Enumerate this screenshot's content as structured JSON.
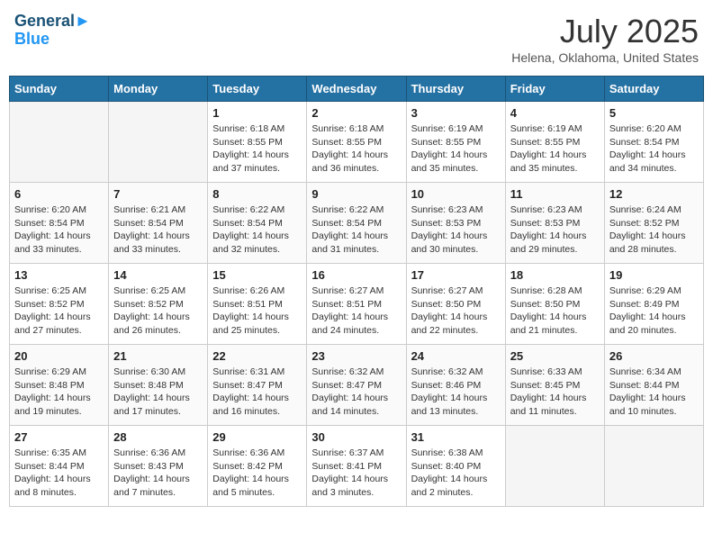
{
  "header": {
    "logo_line1": "General",
    "logo_line2": "Blue",
    "month": "July 2025",
    "location": "Helena, Oklahoma, United States"
  },
  "weekdays": [
    "Sunday",
    "Monday",
    "Tuesday",
    "Wednesday",
    "Thursday",
    "Friday",
    "Saturday"
  ],
  "weeks": [
    [
      {
        "day": "",
        "sunrise": "",
        "sunset": "",
        "daylight": ""
      },
      {
        "day": "",
        "sunrise": "",
        "sunset": "",
        "daylight": ""
      },
      {
        "day": "1",
        "sunrise": "Sunrise: 6:18 AM",
        "sunset": "Sunset: 8:55 PM",
        "daylight": "Daylight: 14 hours and 37 minutes."
      },
      {
        "day": "2",
        "sunrise": "Sunrise: 6:18 AM",
        "sunset": "Sunset: 8:55 PM",
        "daylight": "Daylight: 14 hours and 36 minutes."
      },
      {
        "day": "3",
        "sunrise": "Sunrise: 6:19 AM",
        "sunset": "Sunset: 8:55 PM",
        "daylight": "Daylight: 14 hours and 35 minutes."
      },
      {
        "day": "4",
        "sunrise": "Sunrise: 6:19 AM",
        "sunset": "Sunset: 8:55 PM",
        "daylight": "Daylight: 14 hours and 35 minutes."
      },
      {
        "day": "5",
        "sunrise": "Sunrise: 6:20 AM",
        "sunset": "Sunset: 8:54 PM",
        "daylight": "Daylight: 14 hours and 34 minutes."
      }
    ],
    [
      {
        "day": "6",
        "sunrise": "Sunrise: 6:20 AM",
        "sunset": "Sunset: 8:54 PM",
        "daylight": "Daylight: 14 hours and 33 minutes."
      },
      {
        "day": "7",
        "sunrise": "Sunrise: 6:21 AM",
        "sunset": "Sunset: 8:54 PM",
        "daylight": "Daylight: 14 hours and 33 minutes."
      },
      {
        "day": "8",
        "sunrise": "Sunrise: 6:22 AM",
        "sunset": "Sunset: 8:54 PM",
        "daylight": "Daylight: 14 hours and 32 minutes."
      },
      {
        "day": "9",
        "sunrise": "Sunrise: 6:22 AM",
        "sunset": "Sunset: 8:54 PM",
        "daylight": "Daylight: 14 hours and 31 minutes."
      },
      {
        "day": "10",
        "sunrise": "Sunrise: 6:23 AM",
        "sunset": "Sunset: 8:53 PM",
        "daylight": "Daylight: 14 hours and 30 minutes."
      },
      {
        "day": "11",
        "sunrise": "Sunrise: 6:23 AM",
        "sunset": "Sunset: 8:53 PM",
        "daylight": "Daylight: 14 hours and 29 minutes."
      },
      {
        "day": "12",
        "sunrise": "Sunrise: 6:24 AM",
        "sunset": "Sunset: 8:52 PM",
        "daylight": "Daylight: 14 hours and 28 minutes."
      }
    ],
    [
      {
        "day": "13",
        "sunrise": "Sunrise: 6:25 AM",
        "sunset": "Sunset: 8:52 PM",
        "daylight": "Daylight: 14 hours and 27 minutes."
      },
      {
        "day": "14",
        "sunrise": "Sunrise: 6:25 AM",
        "sunset": "Sunset: 8:52 PM",
        "daylight": "Daylight: 14 hours and 26 minutes."
      },
      {
        "day": "15",
        "sunrise": "Sunrise: 6:26 AM",
        "sunset": "Sunset: 8:51 PM",
        "daylight": "Daylight: 14 hours and 25 minutes."
      },
      {
        "day": "16",
        "sunrise": "Sunrise: 6:27 AM",
        "sunset": "Sunset: 8:51 PM",
        "daylight": "Daylight: 14 hours and 24 minutes."
      },
      {
        "day": "17",
        "sunrise": "Sunrise: 6:27 AM",
        "sunset": "Sunset: 8:50 PM",
        "daylight": "Daylight: 14 hours and 22 minutes."
      },
      {
        "day": "18",
        "sunrise": "Sunrise: 6:28 AM",
        "sunset": "Sunset: 8:50 PM",
        "daylight": "Daylight: 14 hours and 21 minutes."
      },
      {
        "day": "19",
        "sunrise": "Sunrise: 6:29 AM",
        "sunset": "Sunset: 8:49 PM",
        "daylight": "Daylight: 14 hours and 20 minutes."
      }
    ],
    [
      {
        "day": "20",
        "sunrise": "Sunrise: 6:29 AM",
        "sunset": "Sunset: 8:48 PM",
        "daylight": "Daylight: 14 hours and 19 minutes."
      },
      {
        "day": "21",
        "sunrise": "Sunrise: 6:30 AM",
        "sunset": "Sunset: 8:48 PM",
        "daylight": "Daylight: 14 hours and 17 minutes."
      },
      {
        "day": "22",
        "sunrise": "Sunrise: 6:31 AM",
        "sunset": "Sunset: 8:47 PM",
        "daylight": "Daylight: 14 hours and 16 minutes."
      },
      {
        "day": "23",
        "sunrise": "Sunrise: 6:32 AM",
        "sunset": "Sunset: 8:47 PM",
        "daylight": "Daylight: 14 hours and 14 minutes."
      },
      {
        "day": "24",
        "sunrise": "Sunrise: 6:32 AM",
        "sunset": "Sunset: 8:46 PM",
        "daylight": "Daylight: 14 hours and 13 minutes."
      },
      {
        "day": "25",
        "sunrise": "Sunrise: 6:33 AM",
        "sunset": "Sunset: 8:45 PM",
        "daylight": "Daylight: 14 hours and 11 minutes."
      },
      {
        "day": "26",
        "sunrise": "Sunrise: 6:34 AM",
        "sunset": "Sunset: 8:44 PM",
        "daylight": "Daylight: 14 hours and 10 minutes."
      }
    ],
    [
      {
        "day": "27",
        "sunrise": "Sunrise: 6:35 AM",
        "sunset": "Sunset: 8:44 PM",
        "daylight": "Daylight: 14 hours and 8 minutes."
      },
      {
        "day": "28",
        "sunrise": "Sunrise: 6:36 AM",
        "sunset": "Sunset: 8:43 PM",
        "daylight": "Daylight: 14 hours and 7 minutes."
      },
      {
        "day": "29",
        "sunrise": "Sunrise: 6:36 AM",
        "sunset": "Sunset: 8:42 PM",
        "daylight": "Daylight: 14 hours and 5 minutes."
      },
      {
        "day": "30",
        "sunrise": "Sunrise: 6:37 AM",
        "sunset": "Sunset: 8:41 PM",
        "daylight": "Daylight: 14 hours and 3 minutes."
      },
      {
        "day": "31",
        "sunrise": "Sunrise: 6:38 AM",
        "sunset": "Sunset: 8:40 PM",
        "daylight": "Daylight: 14 hours and 2 minutes."
      },
      {
        "day": "",
        "sunrise": "",
        "sunset": "",
        "daylight": ""
      },
      {
        "day": "",
        "sunrise": "",
        "sunset": "",
        "daylight": ""
      }
    ]
  ]
}
